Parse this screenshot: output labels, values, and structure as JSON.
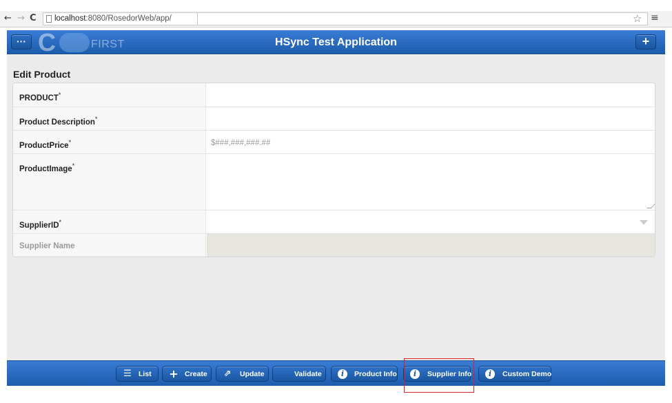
{
  "browser": {
    "back_icon": "←",
    "forward_icon": "→",
    "reload_icon": "C",
    "url_host": "localhost",
    "url_path": ":8080/RosedorWeb/app/",
    "star_icon": "☆",
    "menu_icon": "≡"
  },
  "header": {
    "menu_label": "···",
    "logo_c": "C",
    "logo_text": "FIRST",
    "title": "HSync Test Application",
    "add_label": "+"
  },
  "form": {
    "title": "Edit Product",
    "required_mark": "*",
    "fields": {
      "product": {
        "label": "PRODUCT",
        "value": ""
      },
      "description": {
        "label": "Product Description",
        "value": ""
      },
      "price": {
        "label": "ProductPrice",
        "placeholder": "$###,###,###.##"
      },
      "image": {
        "label": "ProductImage",
        "value": ""
      },
      "supplier_id": {
        "label": "SupplierID",
        "value": ""
      },
      "supplier_name": {
        "label": "Supplier Name",
        "value": ""
      }
    }
  },
  "toolbar": {
    "list": "List",
    "create": "Create",
    "update": "Update",
    "validate": "Validate",
    "product_info": "Product Info",
    "supplier_info": "Supplier Info",
    "custom_demo": "Custom Demo"
  },
  "colors": {
    "header_blue": "#2a6cc4",
    "highlight_red": "#e02020",
    "content_bg": "#ebebeb"
  }
}
